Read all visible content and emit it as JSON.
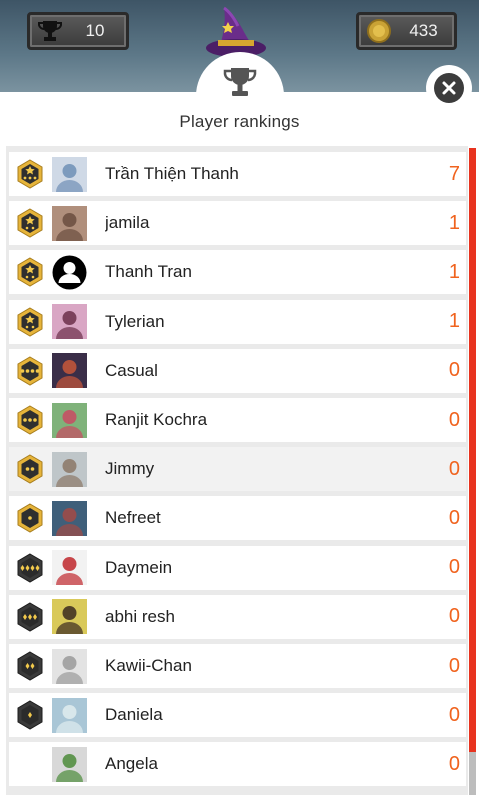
{
  "header": {
    "trophies": "10",
    "coins": "433",
    "title": "Player rankings"
  },
  "colors": {
    "score": "#f0631e",
    "scrollbar": "#e8331f",
    "badge_gold": "#e6b43a",
    "badge_dark": "#3a3a3a"
  },
  "players": [
    {
      "name": "Trần Thiện Thanh",
      "score": "7",
      "avatar": "anime-avatar",
      "badge": "gold-3star"
    },
    {
      "name": "jamila",
      "score": "1",
      "avatar": "photo-avatar",
      "badge": "gold-star"
    },
    {
      "name": "Thanh Tran",
      "score": "1",
      "avatar": "default-person-icon",
      "badge": "gold-star"
    },
    {
      "name": "Tylerian",
      "score": "1",
      "avatar": "photo-avatar",
      "badge": "gold-star"
    },
    {
      "name": "Casual",
      "score": "0",
      "avatar": "anime-avatar",
      "badge": "gold-4dot"
    },
    {
      "name": "Ranjit Kochra",
      "score": "0",
      "avatar": "photo-avatar",
      "badge": "gold-3dot"
    },
    {
      "name": "Jimmy",
      "score": "0",
      "avatar": "photo-avatar",
      "badge": "gold-2dot"
    },
    {
      "name": "Nefreet",
      "score": "0",
      "avatar": "photo-avatar",
      "badge": "gold-1dot"
    },
    {
      "name": "Daymein",
      "score": "0",
      "avatar": "anime-avatar",
      "badge": "dark-4diamond"
    },
    {
      "name": "abhi resh",
      "score": "0",
      "avatar": "photo-avatar",
      "badge": "dark-3diamond"
    },
    {
      "name": "Kawii-Chan",
      "score": "0",
      "avatar": "anime-avatar",
      "badge": "dark-2diamond"
    },
    {
      "name": "Daniela",
      "score": "0",
      "avatar": "photo-avatar",
      "badge": "dark-1diamond"
    },
    {
      "name": "Angela",
      "score": "0",
      "avatar": "cartoon-avatar",
      "badge": "none"
    }
  ]
}
